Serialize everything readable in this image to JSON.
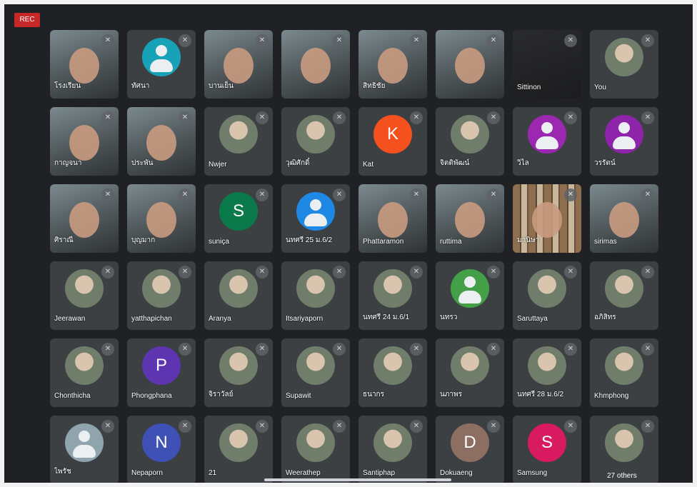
{
  "recording": {
    "label": "REC"
  },
  "participants": [
    {
      "name": "โรงเรียน",
      "kind": "video",
      "icon": "microphone-off-icon"
    },
    {
      "name": "ทัศนา",
      "kind": "avatar",
      "avatar_type": "generic",
      "color": "#17a2b8",
      "icon": "microphone-off-icon"
    },
    {
      "name": "บานเย็น",
      "kind": "video",
      "icon": "microphone-off-icon"
    },
    {
      "name": "",
      "kind": "video",
      "icon": "microphone-off-icon"
    },
    {
      "name": "สิทธิชัย",
      "kind": "video",
      "icon": "microphone-off-icon"
    },
    {
      "name": "",
      "kind": "video",
      "icon": "microphone-off-icon"
    },
    {
      "name": "Sittinon",
      "kind": "dark",
      "icon": "microphone-off-icon"
    },
    {
      "name": "You",
      "kind": "avatar",
      "avatar_type": "photo",
      "icon": "microphone-off-icon"
    },
    {
      "name": "กาญจนา",
      "kind": "video",
      "icon": "microphone-off-icon"
    },
    {
      "name": "ประพัน",
      "kind": "video",
      "icon": "microphone-off-icon"
    },
    {
      "name": "Nwjer",
      "kind": "avatar",
      "avatar_type": "photo",
      "icon": "microphone-off-icon"
    },
    {
      "name": "วุฒิศักดิ์",
      "kind": "avatar",
      "avatar_type": "photo",
      "icon": "microphone-off-icon"
    },
    {
      "name": "Kat",
      "kind": "avatar",
      "avatar_type": "letter",
      "letter": "K",
      "color": "#f4511e",
      "icon": "microphone-off-icon"
    },
    {
      "name": "จิตติพัฒน์",
      "kind": "avatar",
      "avatar_type": "photo",
      "icon": "microphone-off-icon"
    },
    {
      "name": "วิไล",
      "kind": "avatar",
      "avatar_type": "generic",
      "color": "#9c27b0",
      "icon": "microphone-off-icon"
    },
    {
      "name": "วรรัตน์",
      "kind": "avatar",
      "avatar_type": "generic",
      "color": "#8e24aa",
      "icon": "microphone-off-icon"
    },
    {
      "name": "ศิราณี",
      "kind": "video",
      "icon": "microphone-off-icon"
    },
    {
      "name": "บุญมาก",
      "kind": "video",
      "icon": "microphone-off-icon"
    },
    {
      "name": "suniça",
      "kind": "avatar",
      "avatar_type": "letter",
      "letter": "S",
      "color": "#0b7a4a",
      "icon": "microphone-off-icon"
    },
    {
      "name": "นทศรี 25 ม.6/2",
      "kind": "avatar",
      "avatar_type": "generic",
      "color": "#1e88e5",
      "icon": "microphone-off-icon"
    },
    {
      "name": "Phattaramon",
      "kind": "video",
      "icon": "microphone-off-icon"
    },
    {
      "name": "ruttima",
      "kind": "video",
      "icon": "microphone-off-icon"
    },
    {
      "name": "มานิษา",
      "kind": "books",
      "icon": "microphone-off-icon"
    },
    {
      "name": "sirimas",
      "kind": "video",
      "icon": "microphone-off-icon"
    },
    {
      "name": "Jeerawan",
      "kind": "avatar",
      "avatar_type": "photo",
      "icon": "microphone-off-icon"
    },
    {
      "name": "yatthapichan",
      "kind": "avatar",
      "avatar_type": "photo",
      "icon": "microphone-off-icon"
    },
    {
      "name": "Aranya",
      "kind": "avatar",
      "avatar_type": "photo",
      "icon": "microphone-off-icon"
    },
    {
      "name": "Itsariyaporn",
      "kind": "avatar",
      "avatar_type": "photo",
      "icon": "microphone-off-icon"
    },
    {
      "name": "นทศรี 24 ม.6/1",
      "kind": "avatar",
      "avatar_type": "photo",
      "icon": "microphone-off-icon"
    },
    {
      "name": "นทรว",
      "kind": "avatar",
      "avatar_type": "generic",
      "color": "#43a047",
      "icon": "microphone-off-icon"
    },
    {
      "name": "Saruttaya",
      "kind": "avatar",
      "avatar_type": "photo",
      "icon": "microphone-off-icon"
    },
    {
      "name": "อภิสิทร",
      "kind": "avatar",
      "avatar_type": "photo",
      "icon": "microphone-off-icon"
    },
    {
      "name": "Chonthicha",
      "kind": "avatar",
      "avatar_type": "photo",
      "icon": "microphone-off-icon"
    },
    {
      "name": "Phongphana",
      "kind": "avatar",
      "avatar_type": "letter",
      "letter": "P",
      "color": "#5e35b1",
      "icon": "microphone-off-icon"
    },
    {
      "name": "จิราวัลย์",
      "kind": "avatar",
      "avatar_type": "photo",
      "icon": "microphone-off-icon"
    },
    {
      "name": "Supawit",
      "kind": "avatar",
      "avatar_type": "photo",
      "icon": "microphone-off-icon"
    },
    {
      "name": "ธนากร",
      "kind": "avatar",
      "avatar_type": "photo",
      "icon": "microphone-off-icon"
    },
    {
      "name": "นภาพร",
      "kind": "avatar",
      "avatar_type": "photo",
      "icon": "microphone-off-icon"
    },
    {
      "name": "นทศรี 28 ม.6/2",
      "kind": "avatar",
      "avatar_type": "photo",
      "icon": "microphone-off-icon"
    },
    {
      "name": "Khmphong",
      "kind": "avatar",
      "avatar_type": "photo",
      "icon": "microphone-off-icon"
    },
    {
      "name": "ไพรัช",
      "kind": "avatar",
      "avatar_type": "generic",
      "color": "#90a4ae",
      "icon": "microphone-off-icon"
    },
    {
      "name": "Nepaporn",
      "kind": "avatar",
      "avatar_type": "letter",
      "letter": "N",
      "color": "#3f51b5",
      "icon": "microphone-off-icon"
    },
    {
      "name": "21",
      "kind": "avatar",
      "avatar_type": "photo",
      "icon": "microphone-off-icon"
    },
    {
      "name": "Weerathep",
      "kind": "avatar",
      "avatar_type": "photo",
      "icon": "microphone-off-icon"
    },
    {
      "name": "Santiphap",
      "kind": "avatar",
      "avatar_type": "photo",
      "icon": "microphone-off-icon"
    },
    {
      "name": "Dokuaeng",
      "kind": "avatar",
      "avatar_type": "letter",
      "letter": "D",
      "color": "#8d6e63",
      "icon": "microphone-off-icon"
    },
    {
      "name": "Samsung",
      "kind": "avatar",
      "avatar_type": "letter",
      "letter": "S",
      "color": "#d81b60",
      "icon": "microphone-off-icon"
    },
    {
      "name": "",
      "kind": "avatar",
      "avatar_type": "photo",
      "others_label": "27 others",
      "icon": "microphone-off-icon"
    }
  ]
}
